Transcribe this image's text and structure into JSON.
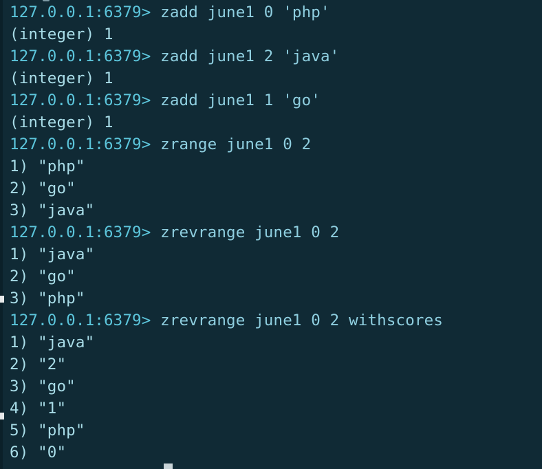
{
  "terminal": {
    "prompt": "127.0.0.1:6379> ",
    "entries": [
      {
        "type": "command",
        "text": "zadd june1 0 'php'"
      },
      {
        "type": "output",
        "text": "(integer) 1"
      },
      {
        "type": "command",
        "text": "zadd june1 2 'java'"
      },
      {
        "type": "output",
        "text": "(integer) 1"
      },
      {
        "type": "command",
        "text": "zadd june1 1 'go'"
      },
      {
        "type": "output",
        "text": "(integer) 1"
      },
      {
        "type": "command",
        "text": "zrange june1 0 2"
      },
      {
        "type": "output",
        "text": "1) \"php\""
      },
      {
        "type": "output",
        "text": "2) \"go\""
      },
      {
        "type": "output",
        "text": "3) \"java\""
      },
      {
        "type": "command",
        "text": "zrevrange june1 0 2"
      },
      {
        "type": "output",
        "text": "1) \"java\""
      },
      {
        "type": "output",
        "text": "2) \"go\""
      },
      {
        "type": "output",
        "text": "3) \"php\""
      },
      {
        "type": "command",
        "text": "zrevrange june1 0 2 withscores"
      },
      {
        "type": "output",
        "text": "1) \"java\""
      },
      {
        "type": "output",
        "text": "2) \"2\""
      },
      {
        "type": "output",
        "text": "3) \"go\""
      },
      {
        "type": "output",
        "text": "4) \"1\""
      },
      {
        "type": "output",
        "text": "5) \"php\""
      },
      {
        "type": "output",
        "text": "6) \"0\""
      }
    ]
  },
  "colors": {
    "background": "#102a35",
    "prompt": "#5cc5db",
    "text": "#a9dde8"
  }
}
